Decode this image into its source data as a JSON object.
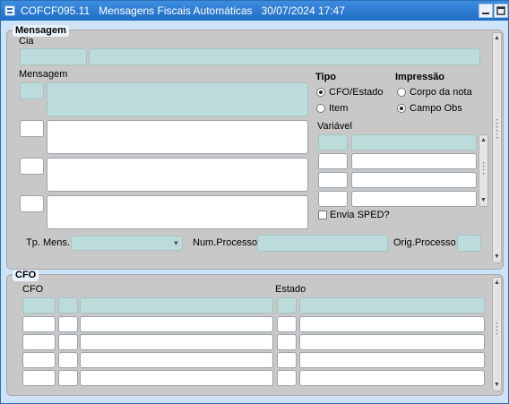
{
  "window": {
    "title": "COFCF095.11   Mensagens Fiscais Automáticas   30/07/2024 17:47",
    "icon": "form-icon",
    "minimize_icon": "minimize-icon",
    "maximize_icon": "maximize-icon"
  },
  "mensagem_panel": {
    "title": "Mensagem",
    "cia_label": "Cia",
    "mensagem_label": "Mensagem",
    "tipo_label": "Tipo",
    "tipo_options": [
      {
        "label": "CFO/Estado",
        "selected": true
      },
      {
        "label": "Item",
        "selected": false
      }
    ],
    "impressao_label": "Impressão",
    "impressao_options": [
      {
        "label": "Corpo da nota",
        "selected": false
      },
      {
        "label": "Campo Obs",
        "selected": true
      }
    ],
    "variavel_label": "Variável",
    "envia_sped_label": "Envia SPED?",
    "envia_sped_checked": false,
    "tp_mens_label": "Tp. Mens.",
    "num_processo_label": "Num.Processo",
    "orig_processo_label": "Orig.Processo"
  },
  "cfo_panel": {
    "title": "CFO",
    "cfo_label": "CFO",
    "estado_label": "Estado"
  },
  "colors": {
    "title_bar": "#1f6cc4",
    "field_teal": "#bcdcdc",
    "panel_gray": "#c8c8c8",
    "background": "#cfe3f7"
  }
}
